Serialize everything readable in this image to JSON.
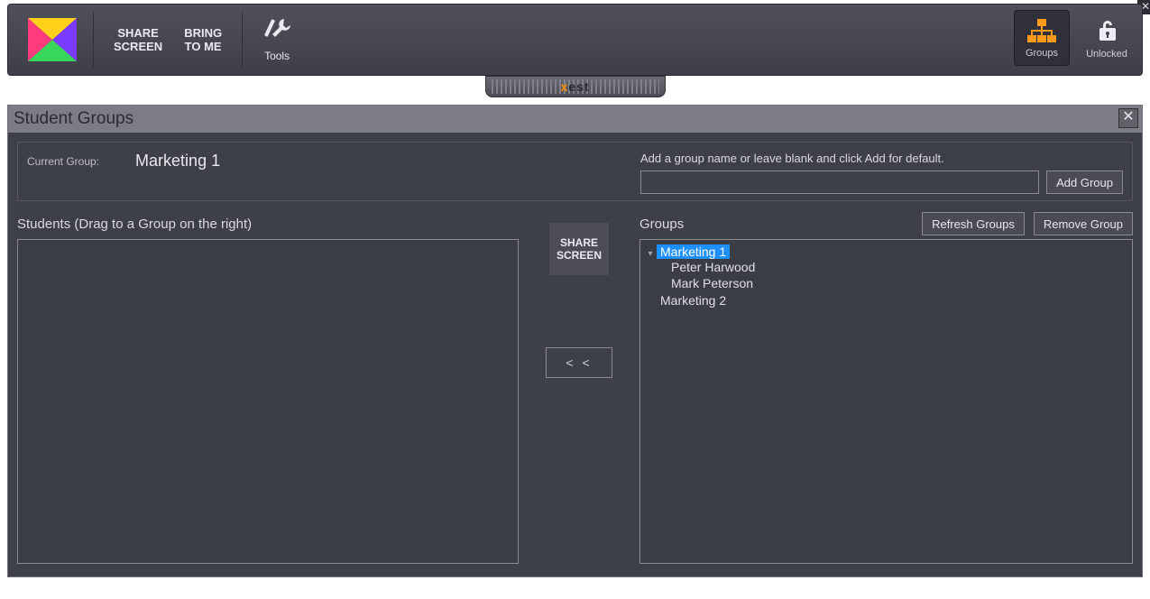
{
  "toolbar": {
    "share_screen": "SHARE\nSCREEN",
    "bring_to_me": "BRING\nTO ME",
    "tools": "Tools",
    "groups": "Groups",
    "unlocked": "Unlocked",
    "brand": "est"
  },
  "panel": {
    "title": "Student Groups",
    "current_group_label": "Current Group:",
    "current_group_value": "Marketing 1",
    "add_hint": "Add a group name or leave blank and click Add for default.",
    "add_button": "Add Group",
    "students_heading": "Students (Drag to a Group on the right)",
    "groups_heading": "Groups",
    "refresh_button": "Refresh Groups",
    "remove_button": "Remove Group",
    "share_tile": "SHARE\nSCREEN",
    "move_left": "< <",
    "group_name_value": ""
  },
  "tree": {
    "groups": [
      {
        "name": "Marketing 1",
        "selected": true,
        "expanded": true,
        "members": [
          "Peter Harwood",
          "Mark Peterson"
        ]
      },
      {
        "name": "Marketing 2",
        "selected": false,
        "expanded": false,
        "members": []
      }
    ]
  },
  "colors": {
    "accent_orange": "#ff8a00",
    "selection_blue": "#1e90ff"
  }
}
